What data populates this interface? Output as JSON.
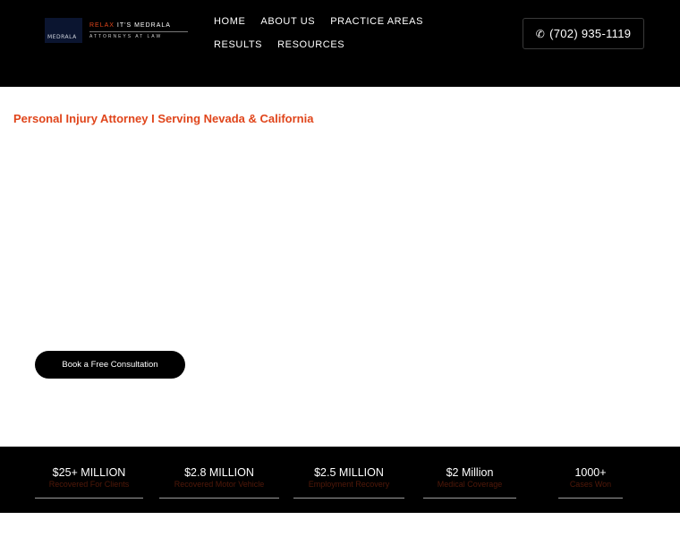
{
  "brand": {
    "mark_text": "MEDRALA",
    "tagline_accent": "RELAX",
    "tagline_rest": " IT'S MEDRALA",
    "subtitle": "ATTORNEYS AT LAW"
  },
  "nav": {
    "items": [
      {
        "label": "HOME"
      },
      {
        "label": "ABOUT US"
      },
      {
        "label": "PRACTICE AREAS"
      },
      {
        "label": "RESULTS"
      },
      {
        "label": "RESOURCES"
      }
    ]
  },
  "header": {
    "phone_icon": "phone-icon",
    "phone_label": "(702) 935-1119"
  },
  "hero": {
    "heading": "Personal Injury Attorney I Serving Nevada & California",
    "cta_label": "Book a Free Consultation"
  },
  "stats": [
    {
      "value": "$25+ MILLION",
      "label": "Recovered For Clients"
    },
    {
      "value": "$2.8 MILLION",
      "label": "Recovered Motor Vehicle"
    },
    {
      "value": "$2.5 MILLION",
      "label": "Employment Recovery"
    },
    {
      "value": "$2 Million",
      "label": "Medical Coverage"
    },
    {
      "value": "1000+",
      "label": "Cases Won"
    }
  ],
  "colors": {
    "accent": "#e0451b",
    "header_bg": "#000000",
    "page_bg": "#ffffff"
  }
}
